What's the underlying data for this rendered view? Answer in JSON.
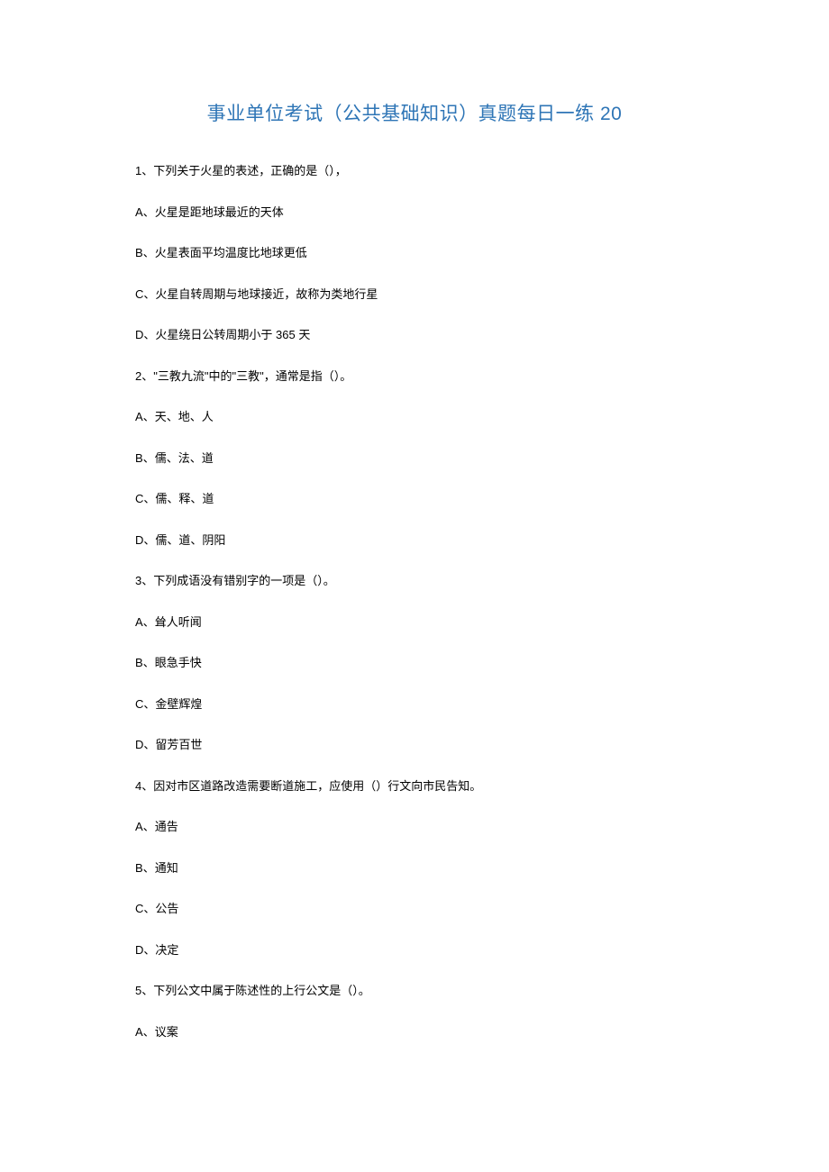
{
  "title": "事业单位考试（公共基础知识）真题每日一练 20",
  "questions": [
    {
      "num": "1",
      "text": "下列关于火星的表述，正确的是（），",
      "options": [
        {
          "label": "A",
          "text": "火星是距地球最近的天体"
        },
        {
          "label": "B",
          "text": "火星表面平均温度比地球更低"
        },
        {
          "label": "C",
          "text": "火星自转周期与地球接近，故称为类地行星"
        },
        {
          "label": "D",
          "text": "火星绕日公转周期小于 365 天"
        }
      ]
    },
    {
      "num": "2",
      "text": "\"三教九流\"中的\"三教\"，通常是指（）。",
      "options": [
        {
          "label": "A",
          "text": "天、地、人"
        },
        {
          "label": "B",
          "text": "儒、法、道"
        },
        {
          "label": "C",
          "text": "儒、释、道"
        },
        {
          "label": "D",
          "text": "儒、道、阴阳"
        }
      ]
    },
    {
      "num": "3",
      "text": "下列成语没有错别字的一项是（）。",
      "options": [
        {
          "label": "A",
          "text": "耸人听闻"
        },
        {
          "label": "B",
          "text": "眼急手快"
        },
        {
          "label": "C",
          "text": "金壁辉煌"
        },
        {
          "label": "D",
          "text": "留芳百世"
        }
      ]
    },
    {
      "num": "4",
      "text": "因对市区道路改造需要断道施工，应使用（）行文向市民告知。",
      "options": [
        {
          "label": "A",
          "text": "通告"
        },
        {
          "label": "B",
          "text": "通知"
        },
        {
          "label": "C",
          "text": "公告"
        },
        {
          "label": "D",
          "text": "决定"
        }
      ]
    },
    {
      "num": "5",
      "text": "下列公文中属于陈述性的上行公文是（）。",
      "options": [
        {
          "label": "A",
          "text": "议案"
        }
      ]
    }
  ]
}
